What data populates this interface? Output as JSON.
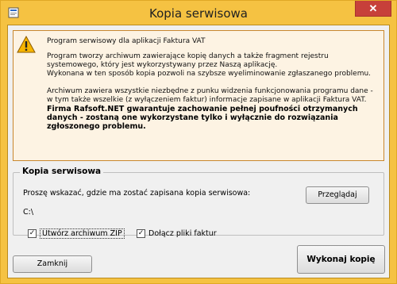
{
  "window": {
    "title": "Kopia serwisowa",
    "close_glyph": "✕",
    "accent_color": "#f5c242",
    "close_color": "#c7403a"
  },
  "info": {
    "icon": "warning-icon",
    "line1": "Program serwisowy dla aplikacji Faktura VAT",
    "line2": "Program tworzy archiwum zawierające kopię danych a także fragment rejestru systemowego, który jest wykorzystywany przez Naszą aplikację.",
    "line3": "Wykonana w ten sposób kopia pozwoli na szybsze wyeliminowanie zgłaszanego problemu.",
    "line4": "Archiwum zawiera wszystkie niezbędne z punku widzenia funkcjonowania programu dane - w tym także wszelkie (z wyłączeniem faktur) informacje zapisane w aplikacji Faktura VAT.",
    "bold_note": "Firma Rafsoft.NET gwarantuje zachowanie pełnej poufności otrzymanych danych - zostaną one wykorzystane tylko i wyłącznie do rozwiązania zgłoszonego problemu."
  },
  "backup_group": {
    "title": "Kopia serwisowa",
    "prompt": "Proszę wskazać, gdzie ma zostać zapisana kopia serwisowa:",
    "path": "C:\\",
    "browse_label": "Przeglądaj",
    "zip_label": "Utwórz archiwum ZIP",
    "zip_checked": true,
    "invoices_label": "Dołącz pliki faktur",
    "invoices_checked": true,
    "check_glyph": "✓"
  },
  "footer": {
    "close_label": "Zamknij",
    "backup_label": "Wykonaj kopię"
  }
}
